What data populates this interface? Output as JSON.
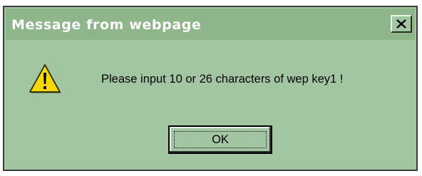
{
  "dialog": {
    "title": "Message from webpage",
    "message": "Please input 10 or 26 characters of wep key1 !",
    "ok_label": "OK",
    "close_label": "X",
    "icon": "warning-icon"
  },
  "colors": {
    "dialog_background": "#a3c6a2",
    "titlebar_background": "#8fb58b",
    "title_text": "#ffffff",
    "warning_yellow": "#f5d800"
  }
}
